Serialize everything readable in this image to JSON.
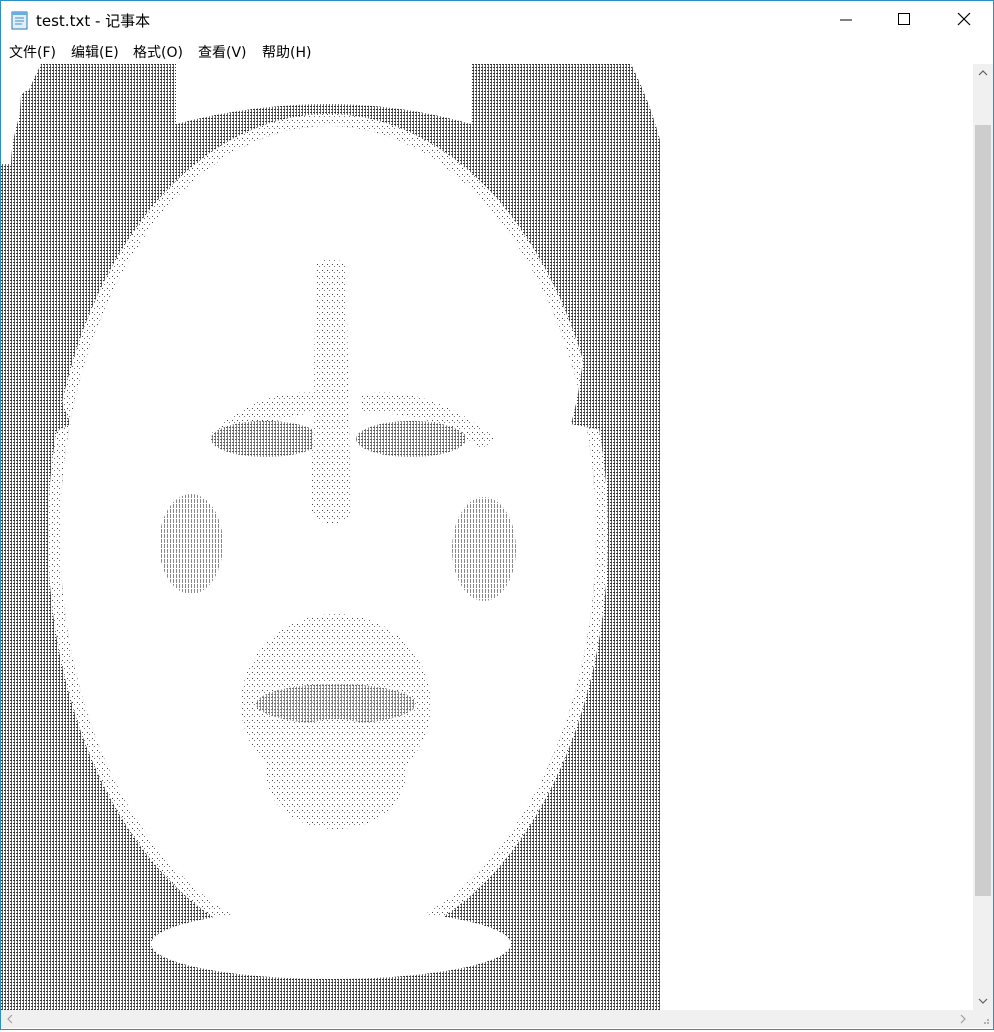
{
  "window": {
    "title": "test.txt - 记事本",
    "icon": "notepad-icon"
  },
  "controls": {
    "minimize": "minimize-icon",
    "maximize": "maximize-icon",
    "close": "close-icon"
  },
  "menu": [
    {
      "label": "文件(F)"
    },
    {
      "label": "编辑(E)"
    },
    {
      "label": "格式(O)"
    },
    {
      "label": "查看(V)"
    },
    {
      "label": "帮助(H)"
    }
  ],
  "colors": {
    "window_border": "#2b90c8",
    "ascii_text": "#000000",
    "scrollbar_track": "#f0f0f0",
    "scrollbar_thumb": "#cdcdcd"
  }
}
